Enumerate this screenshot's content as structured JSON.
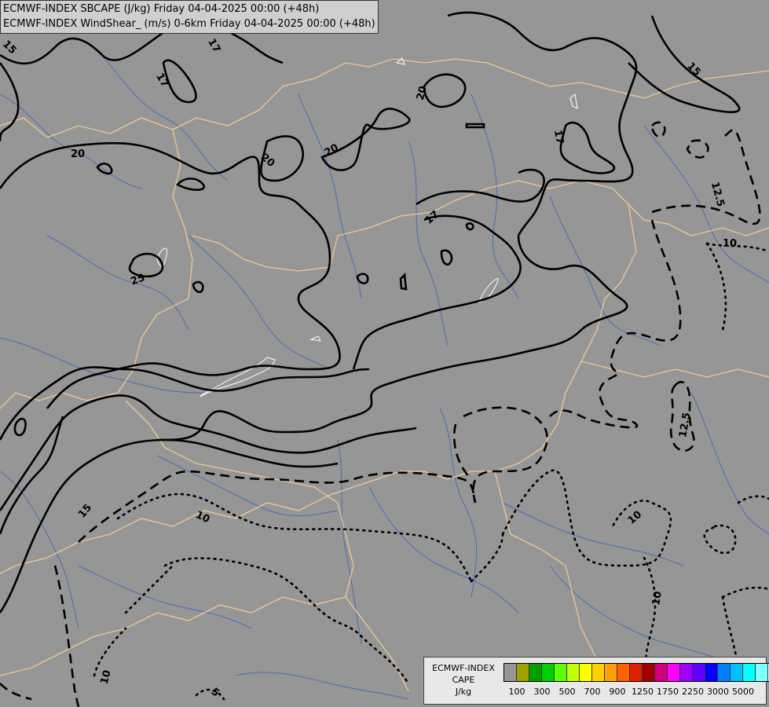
{
  "title": {
    "line1": "ECMWF-INDEX SBCAPE (J/kg) Friday 04-04-2025 00:00 (+48h)",
    "line2": "ECMWF-INDEX WindShear_ (m/s) 0-6km Friday 04-04-2025 00:00 (+48h)"
  },
  "contour_labels": [
    "15",
    "17",
    "17",
    "20",
    "20",
    "20",
    "20",
    "25",
    "17",
    "15",
    "17",
    "12.5",
    "10",
    "12.5",
    "15",
    "10",
    "10",
    "10",
    "10",
    "5"
  ],
  "legend": {
    "title_lines": [
      "ECMWF-INDEX",
      "CAPE",
      "J/kg"
    ],
    "colors": [
      "#969696",
      "#a0a000",
      "#00a000",
      "#00d000",
      "#60ff00",
      "#c0ff00",
      "#ffff00",
      "#ffd000",
      "#ffa000",
      "#ff6000",
      "#e02000",
      "#a00000",
      "#d00080",
      "#ff00ff",
      "#a000ff",
      "#6000ff",
      "#0000ff",
      "#0080ff",
      "#00c0ff",
      "#00ffff",
      "#80ffff",
      "#ffffff"
    ],
    "tick_labels": [
      "100",
      "300",
      "500",
      "700",
      "900",
      "1250",
      "1750",
      "2250",
      "3000",
      "5000"
    ]
  },
  "colors": {
    "background": "#969696",
    "borders": "#f5c890",
    "rivers": "#4060b0",
    "contours": "#000000",
    "lakes": "#ffffff"
  }
}
